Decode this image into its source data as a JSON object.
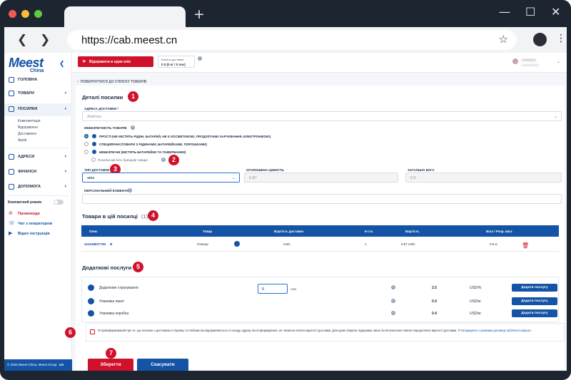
{
  "browser": {
    "url": "https://cab.meest.cn",
    "new_tab": "+",
    "back_arrow": "❮",
    "forward_arrow": "❯",
    "window_minimize": "—",
    "window_maximize": "☐",
    "window_close": "✕",
    "traffic_light_colors": [
      "#ee5b54",
      "#f5bd3a",
      "#5fc93f"
    ]
  },
  "sidebar": {
    "logo": "Meest",
    "logo_sub": "China",
    "items": [
      {
        "label": "ГОЛОВНА",
        "icon": "home-icon"
      },
      {
        "label": "ТОВАРИ",
        "icon": "package-icon",
        "chevron": "›"
      },
      {
        "label": "ПОСИЛКИ",
        "icon": "box-icon",
        "chevron": "‹"
      },
      {
        "label": "АДРЕСИ",
        "icon": "location-icon",
        "chevron": "›"
      },
      {
        "label": "ФІНАНСИ",
        "icon": "wallet-icon",
        "chevron": "›"
      },
      {
        "label": "ДОПОМОГА",
        "icon": "help-icon",
        "chevron": "›"
      }
    ],
    "subitems": [
      "Комплектація",
      "Відправлені",
      "Доставлені",
      "Архів"
    ],
    "compact_mode": "Компактний режим",
    "links": [
      {
        "label": "Промокоди",
        "icon": "promo-icon",
        "color": "#d0112b"
      },
      {
        "label": "Чат з оператором",
        "icon": "chat-icon",
        "color": "#1453a6"
      },
      {
        "label": "Відео інструкція",
        "icon": "video-icon",
        "color": "#1453a6"
      }
    ],
    "footer": "© 2025 Meest China, Meest Group",
    "footer_lang": "UA"
  },
  "topbar": {
    "send_one_click": "Відправити в один клік",
    "balance_label": "Баланс доставки",
    "balance_value": "0 $ (0 кг / 0 пос)",
    "balance_help": "?"
  },
  "content": {
    "back_link": "ПОВЕРНУТИСЯ ДО СПИСКУ ТОВАРІВ",
    "parcel_details": {
      "title": "Деталі посилки",
      "badge": "1",
      "address_label": "АДРЕСА ДОСТАВКИ *",
      "address_placeholder": "Address",
      "hazard_label": "НЕБЕЗПЕЧНІСТЬ ТОВАРІВ",
      "hazard_options": [
        "ПРОСТІ (НЕ МІСТЯТЬ РІДИН, БАТАРЕЙ, НЕ Є КОСМЕТИКОЮ, ПРОДУКТАМИ ХАРЧУВАННЯ, ЕЛЕКТРОНІКОЮ)",
        "СПЕЦИФІЧНІ (ТОВАРИ З РІДИНАМИ, БАТАРЕЙКАМИ, ПОРОШКАМИ)",
        "НЕБЕЗПЕЧНІ (МІСТЯТЬ БАТАРЕЙКИ ТА ПАВЕРБАНКИ)"
      ],
      "branded_label": "Посилка містить брендові товари",
      "badge2": "2",
      "delivery_type_label": "ТИП ДОСТАВКИ",
      "delivery_type_value": "авіа",
      "badge3": "3",
      "declared_value_label": "ОГОЛОШЕНА ЦІННІСТЬ",
      "declared_value": "6.87",
      "total_weight_label": "ЗАГАЛЬНА ВАГА",
      "total_weight": "0.5",
      "comment_label": "ПЕРСОНАЛЬНИЙ КОМЕНТАР"
    },
    "goods": {
      "title": "Товари в цій посилці",
      "count": "(1)",
      "badge": "4",
      "columns": [
        "Опис",
        "Товар",
        "Вартість доставки",
        "К-сть",
        "Вартість",
        "Вага / Розр. вага"
      ],
      "rows": [
        {
          "desc": "424248837795",
          "item": "Планер",
          "currency": "USD",
          "qty": "1",
          "price": "6.87 USD",
          "weight": "0.5 кг"
        }
      ]
    },
    "services": {
      "title": "Додаткові послуги",
      "badge": "5",
      "insurance_input": "0",
      "insurance_currency": "USD",
      "rows": [
        {
          "name": "Додаткове страхування",
          "price": "2.5",
          "unit": "USD/%",
          "button": "Додати послугу"
        },
        {
          "name": "Упаковка пакет",
          "price": "0.4",
          "unit": "USD/кг.",
          "button": "Додати послугу"
        },
        {
          "name": "Упаковка коробка",
          "price": "0.4",
          "unit": "USD/кг.",
          "button": "Додати послугу"
        }
      ]
    },
    "consent": {
      "badge": "6",
      "text": "Я проінформований про те, що посилки з доставкою в Україну та Узбекистан відправляються зі складу одразу після формування, не чекаючи оплати вартості доставки. Для країн Європи, відправка лише після внесення повної передоплати вартості доставки.",
      "link": "Я погоджуюся з умовами договору публічної оферти."
    },
    "actions": {
      "badge": "7",
      "save": "Зберегти",
      "cancel": "Скасувати"
    }
  }
}
